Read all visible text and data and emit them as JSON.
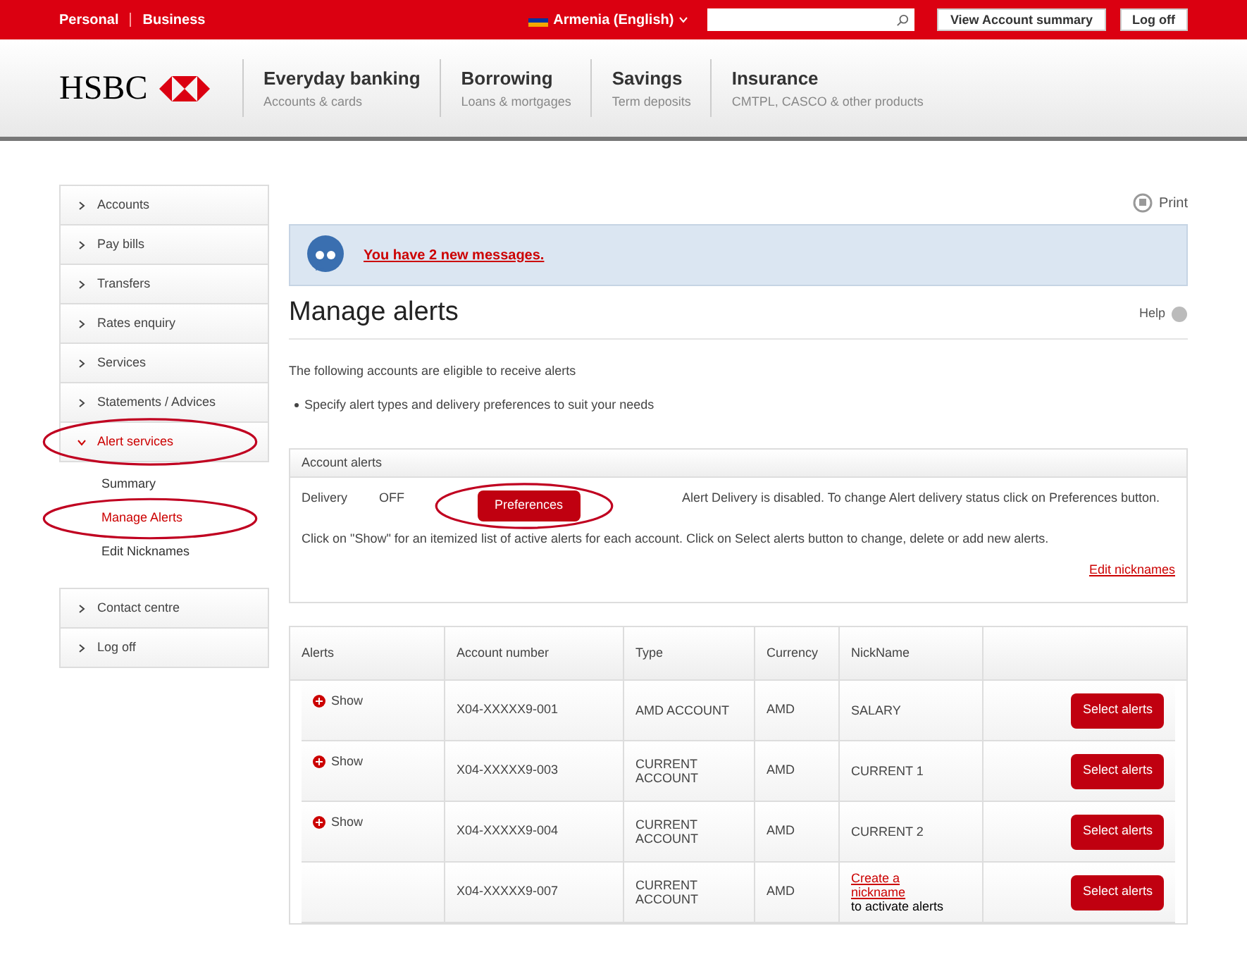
{
  "top_bar": {
    "segments": [
      "Personal",
      "Business"
    ],
    "region": "Armenia (English)",
    "buttons": [
      "View Account summary",
      "Log off"
    ]
  },
  "header": {
    "logo": "HSBC",
    "nav": [
      {
        "title": "Everyday banking",
        "subtitle": "Accounts & cards"
      },
      {
        "title": "Borrowing",
        "subtitle": "Loans & mortgages"
      },
      {
        "title": "Savings",
        "subtitle": "Term deposits"
      },
      {
        "title": "Insurance",
        "subtitle": "CMTPL, CASCO & other products"
      }
    ]
  },
  "sidebar": {
    "groups": [
      [
        {
          "label": "Accounts",
          "expanded": false,
          "highlighted": false
        },
        {
          "label": "Pay bills",
          "expanded": false,
          "highlighted": false
        },
        {
          "label": "Transfers",
          "expanded": false,
          "highlighted": false
        },
        {
          "label": "Rates enquiry",
          "expanded": false,
          "highlighted": false
        },
        {
          "label": "Services",
          "expanded": false,
          "highlighted": false
        },
        {
          "label": "Statements / Advices",
          "expanded": false,
          "highlighted": false
        },
        {
          "label": "Alert services",
          "expanded": true,
          "highlighted": true,
          "children": [
            {
              "label": "Summary",
              "selected": false,
              "highlighted": false
            },
            {
              "label": "Manage Alerts",
              "selected": true,
              "highlighted": true
            },
            {
              "label": "Edit Nicknames",
              "selected": false,
              "highlighted": false
            }
          ]
        }
      ],
      [
        {
          "label": "Contact centre",
          "expanded": false,
          "highlighted": false
        },
        {
          "label": "Log off",
          "expanded": false,
          "highlighted": false
        }
      ]
    ]
  },
  "print": "Print",
  "message": "You have 2 new messages.",
  "title": "Manage alerts",
  "help": "Help",
  "intro": "The following accounts are eligible to receive alerts",
  "bullet": "Specify alert types and delivery preferences to suit your needs",
  "account_alerts": {
    "heading": "Account alerts",
    "delivery_label": "Delivery",
    "delivery_value": "OFF",
    "button": "Preferences",
    "button_highlighted": true,
    "status": "Alert Delivery is disabled. To change Alert delivery status click on Preferences button.",
    "hint": "Click on \"Show\" for an itemized list of active alerts for each account. Click on Select alerts button to change, delete or add new alerts.",
    "link": "Edit nicknames"
  },
  "table": {
    "columns": [
      "Alerts",
      "Account number",
      "Type",
      "Currency",
      "NickName"
    ],
    "rows": [
      {
        "show": "Show",
        "account": "X04-XXXXX9-001",
        "type": "AMD ACCOUNT",
        "currency": "AMD",
        "nickname": {
          "kind": "text",
          "text": "SALARY"
        },
        "button": "Select alerts"
      },
      {
        "show": "Show",
        "account": "X04-XXXXX9-003",
        "type": "CURRENT ACCOUNT",
        "currency": "AMD",
        "nickname": {
          "kind": "text",
          "text": "CURRENT 1"
        },
        "button": "Select alerts"
      },
      {
        "show": "Show",
        "account": "X04-XXXXX9-004",
        "type": "CURRENT ACCOUNT",
        "currency": "AMD",
        "nickname": {
          "kind": "text",
          "text": "CURRENT 2"
        },
        "button": "Select alerts"
      },
      {
        "account": "X04-XXXXX9-007",
        "type": "CURRENT ACCOUNT",
        "currency": "AMD",
        "nickname": {
          "kind": "link",
          "link": "Create a nickname",
          "note": "to activate alerts"
        },
        "button": "Select alerts"
      }
    ]
  }
}
